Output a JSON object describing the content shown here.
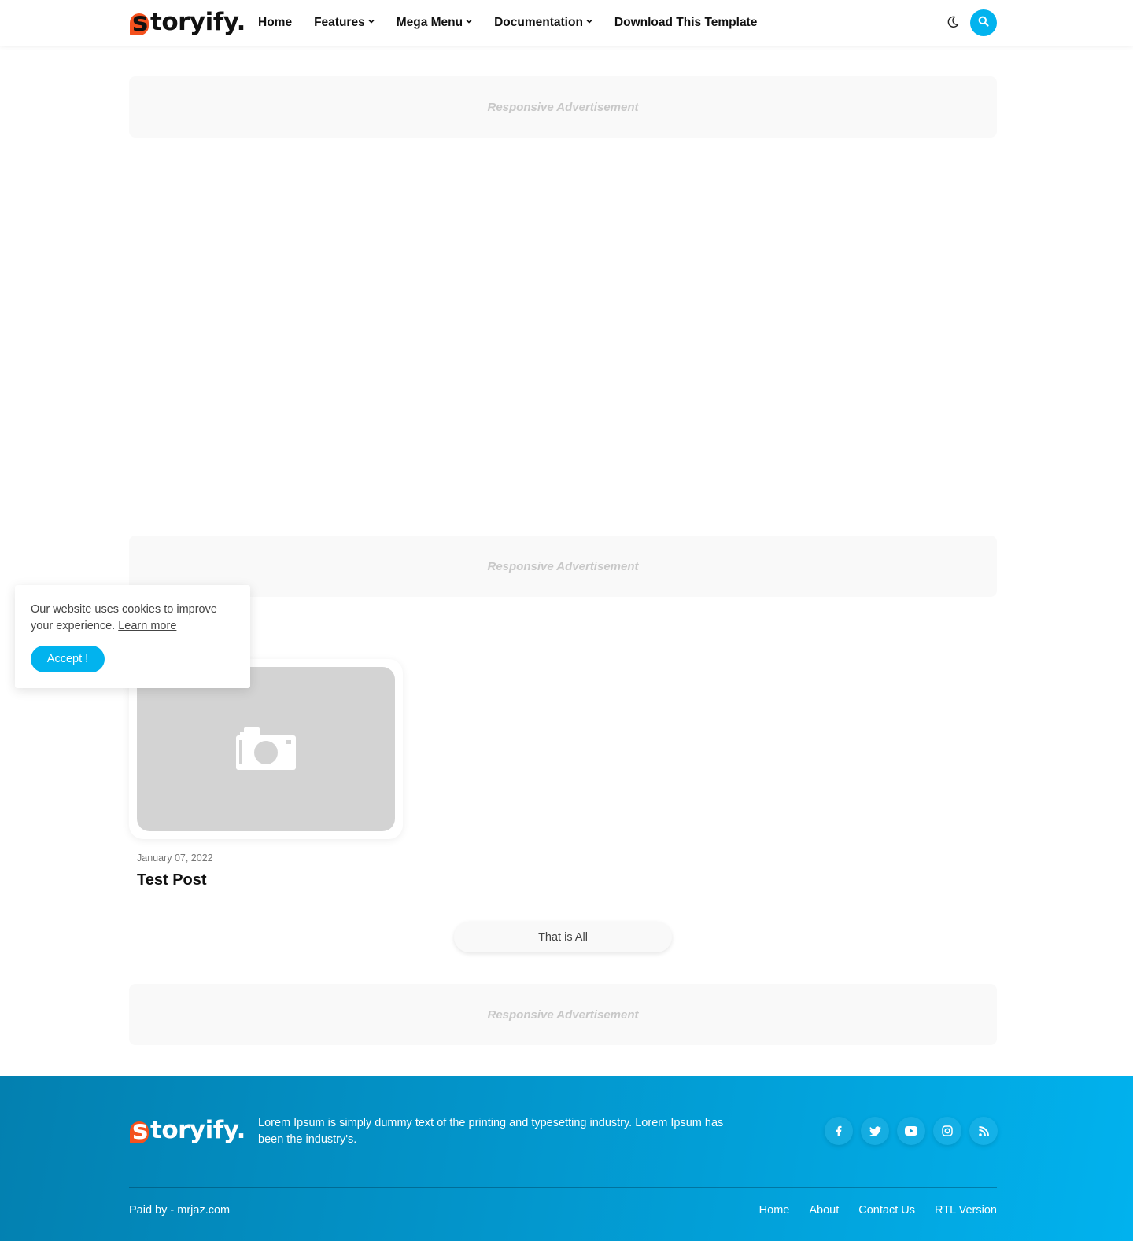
{
  "header": {
    "logo_first": "s",
    "logo_rest": "toryify.",
    "nav": [
      {
        "label": "Home",
        "dropdown": false
      },
      {
        "label": "Features",
        "dropdown": true
      },
      {
        "label": "Mega Menu",
        "dropdown": true
      },
      {
        "label": "Documentation",
        "dropdown": true
      },
      {
        "label": "Download This Template",
        "dropdown": false
      }
    ],
    "theme_icon": "moon-icon",
    "search_icon": "search-icon"
  },
  "ads": {
    "top_label": "Responsive Advertisement",
    "middle_label": "Responsive Advertisement",
    "bottom_label": "Responsive Advertisement"
  },
  "post": {
    "thumbnail_icon": "camera-icon",
    "date": "January 07, 2022",
    "title": "Test Post"
  },
  "load_more": {
    "label": "That is All"
  },
  "cookie": {
    "text": "Our website uses cookies to improve your experience.",
    "learn_more": "Learn more",
    "accept": "Accept !"
  },
  "footer": {
    "logo_first": "s",
    "logo_rest": "toryify.",
    "description": "Lorem Ipsum is simply dummy text of the printing and typesetting industry. Lorem Ipsum has been the industry's.",
    "socials": [
      "facebook-icon",
      "twitter-icon",
      "youtube-icon",
      "instagram-icon",
      "rss-icon"
    ],
    "credit": "Paid by - mrjaz.com",
    "links": [
      "Home",
      "About",
      "Contact Us",
      "RTL Version"
    ]
  },
  "colors": {
    "accent": "#02b3ee",
    "logo_mark": "#f4511e",
    "footer_start": "#0380b0",
    "footer_end": "#01b2ee"
  }
}
